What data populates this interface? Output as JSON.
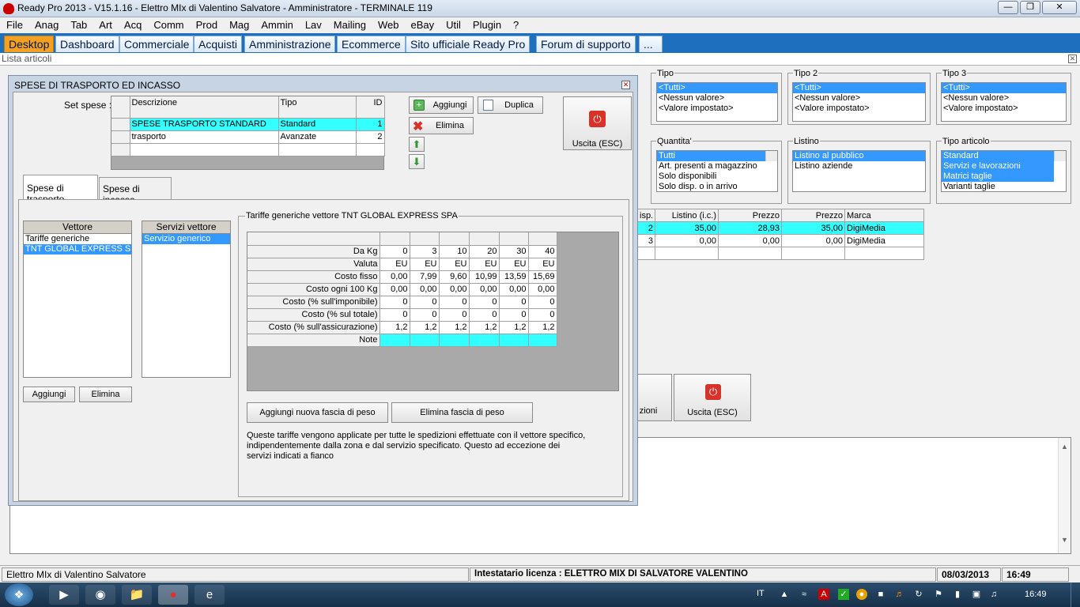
{
  "window": {
    "title": "Ready Pro 2013 - V15.1.16 - Elettro MIx di Valentino Salvatore - Amministratore - TERMINALE 119"
  },
  "menu": [
    "File",
    "Anag",
    "Tab",
    "Art",
    "Acq",
    "Comm",
    "Prod",
    "Mag",
    "Ammin",
    "Lav",
    "Mailing",
    "Web",
    "eBay",
    "Util",
    "Plugin",
    "?"
  ],
  "tabs": [
    "Desktop",
    "Dashboard",
    "Commerciale",
    "Acquisti",
    "Amministrazione",
    "Ecommerce",
    "Sito ufficiale Ready Pro",
    "Forum di supporto",
    "..."
  ],
  "lista": {
    "title": "Lista articoli"
  },
  "filters": {
    "tipo": {
      "label": "Tipo",
      "items": [
        "<Tutti>",
        "<Nessun valore>",
        "<Valore impostato>"
      ]
    },
    "tipo2": {
      "label": "Tipo 2",
      "items": [
        "<Tutti>",
        "<Nessun valore>",
        "<Valore impostato>"
      ]
    },
    "tipo3": {
      "label": "Tipo 3",
      "items": [
        "<Tutti>",
        "<Nessun valore>",
        "<Valore impostato>"
      ]
    },
    "quantita": {
      "label": "Quantita'",
      "items": [
        "Tutti",
        "Art. presenti a magazzino",
        "Solo disponibili",
        "Solo disp. o in arrivo"
      ]
    },
    "listino": {
      "label": "Listino",
      "items": [
        "Listino al pubblico",
        "Listino aziende"
      ]
    },
    "tipo_articolo": {
      "label": "Tipo articolo",
      "items": [
        "Standard",
        "Servizi e lavorazioni",
        "Matrici taglie",
        "Varianti taglie"
      ]
    }
  },
  "articles": {
    "headers": [
      "isp.",
      "Listino (i.c.)",
      "Prezzo",
      "Prezzo",
      "Marca"
    ],
    "rows": [
      [
        "2",
        "35,00",
        "28,93",
        "35,00",
        "DigiMedia"
      ],
      [
        "3",
        "0,00",
        "0,00",
        "0,00",
        "DigiMedia"
      ]
    ]
  },
  "bg_buttons": {
    "azioni": "zioni",
    "uscita": "Uscita (ESC)"
  },
  "dialog": {
    "title": "SPESE DI TRASPORTO ED INCASSO",
    "set_label": "Set spese :",
    "set_headers": [
      "Descrizione",
      "Tipo",
      "ID"
    ],
    "set_rows": [
      [
        "SPESE TRASPORTO STANDARD",
        "Standard",
        "1"
      ],
      [
        "trasporto",
        "Avanzate",
        "2"
      ]
    ],
    "btn_aggiungi": "Aggiungi",
    "btn_duplica": "Duplica",
    "btn_elimina": "Elimina",
    "btn_uscita": "Uscita (ESC)",
    "tab_trasporto": "Spese di trasporto",
    "tab_incasso": "Spese di incasso",
    "vettore_header": "Vettore",
    "vettori": [
      "Tariffe generiche",
      "TNT GLOBAL EXPRESS SPA"
    ],
    "servizi_header": "Servizi vettore",
    "servizi": [
      "Servizio generico"
    ],
    "btn_aggiungi_vettore": "Aggiungi",
    "btn_elimina_vettore": "Elimina",
    "tariffe_title": "Tariffe generiche vettore TNT GLOBAL EXPRESS SPA",
    "tariffe_rows": [
      {
        "label": "Da Kg",
        "values": [
          "0",
          "3",
          "10",
          "20",
          "30",
          "40"
        ]
      },
      {
        "label": "Valuta",
        "values": [
          "EU",
          "EU",
          "EU",
          "EU",
          "EU",
          "EU"
        ]
      },
      {
        "label": "Costo fisso",
        "values": [
          "0,00",
          "7,99",
          "9,60",
          "10,99",
          "13,59",
          "15,69"
        ]
      },
      {
        "label": "Costo ogni 100 Kg",
        "values": [
          "0,00",
          "0,00",
          "0,00",
          "0,00",
          "0,00",
          "0,00"
        ]
      },
      {
        "label": "Costo (% sull'imponibile)",
        "values": [
          "0",
          "0",
          "0",
          "0",
          "0",
          "0"
        ]
      },
      {
        "label": "Costo (% sul totale)",
        "values": [
          "0",
          "0",
          "0",
          "0",
          "0",
          "0"
        ]
      },
      {
        "label": "Costo (% sull'assicurazione)",
        "values": [
          "1,2",
          "1,2",
          "1,2",
          "1,2",
          "1,2",
          "1,2"
        ]
      },
      {
        "label": "Note",
        "values": [
          "",
          "",
          "",
          "",
          "",
          ""
        ]
      }
    ],
    "btn_aggiungi_fascia": "Aggiungi nuova fascia di peso",
    "btn_elimina_fascia": "Elimina fascia di peso",
    "note_text": "Queste tariffe vengono applicate per tutte le spedizioni effettuate con il vettore specifico, indipendentemente dalla zona e dal servizio specificato. Questo ad eccezione dei servizi indicati a fianco"
  },
  "status": {
    "company": "Elettro MIx di Valentino Salvatore",
    "license": "Intestatario licenza : ELETTRO MIX DI SALVATORE VALENTINO",
    "date": "08/03/2013",
    "time": "16:49"
  },
  "taskbar": {
    "lang": "IT",
    "clock": "16:49"
  }
}
